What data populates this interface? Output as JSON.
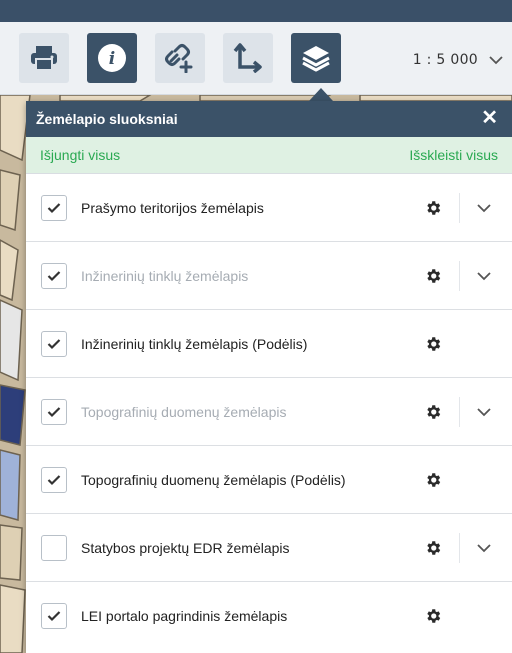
{
  "toolbar": {
    "buttons": [
      {
        "icon": "printer-icon",
        "style": "light"
      },
      {
        "icon": "info-icon",
        "style": "dark"
      },
      {
        "icon": "link-add-icon",
        "style": "light"
      },
      {
        "icon": "axis-measure-icon",
        "style": "light"
      },
      {
        "icon": "layers-icon",
        "style": "dark"
      }
    ],
    "scale_value": "1 : 5 000"
  },
  "panel": {
    "title": "Žemėlapio sluoksniai",
    "close_icon": "close-icon",
    "disable_all": "Išjungti visus",
    "expand_all": "Išskleisti visus",
    "layers": [
      {
        "label": "Prašymo teritorijos žemėlapis",
        "checked": true,
        "dimmed": false,
        "expandable": true
      },
      {
        "label": "Inžinerinių tinklų žemėlapis",
        "checked": true,
        "dimmed": true,
        "expandable": true
      },
      {
        "label": "Inžinerinių tinklų žemėlapis (Podėlis)",
        "checked": true,
        "dimmed": false,
        "expandable": false
      },
      {
        "label": "Topografinių duomenų žemėlapis",
        "checked": true,
        "dimmed": true,
        "expandable": true
      },
      {
        "label": "Topografinių duomenų žemėlapis (Podėlis)",
        "checked": true,
        "dimmed": false,
        "expandable": false
      },
      {
        "label": "Statybos projektų EDR žemėlapis",
        "checked": false,
        "dimmed": false,
        "expandable": true
      },
      {
        "label": "LEI portalo pagrindinis žemėlapis",
        "checked": true,
        "dimmed": false,
        "expandable": false
      }
    ]
  },
  "colors": {
    "header_bg": "#3b5268",
    "action_green": "#2aa952",
    "action_bg": "#dff1e3"
  }
}
